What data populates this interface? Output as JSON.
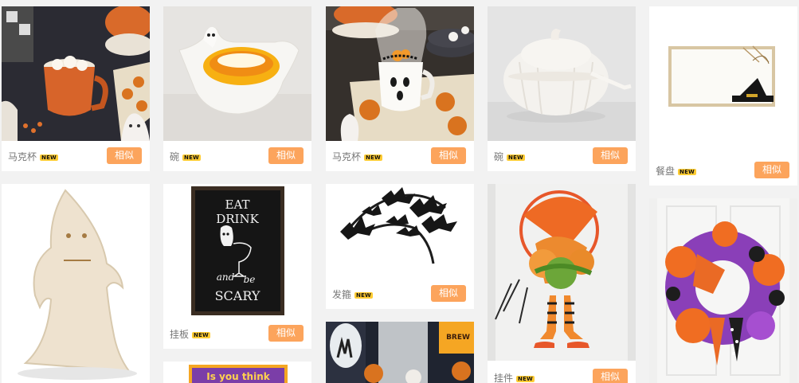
{
  "badge_text": "NEW",
  "similar_label": "相似",
  "accent_color": "#fca45c",
  "cards": [
    {
      "label": "马克杯",
      "image": "mug-with-marshmallows-and-ghost-figurine"
    },
    {
      "label": "碗",
      "image": "ghost-shaped-bowl-with-candy-corn"
    },
    {
      "label": "马克杯",
      "image": "ghost-mug-with-cellophane-gift-bag"
    },
    {
      "label": "碗",
      "image": "white-ceramic-pumpkin-tureen-with-ladle"
    },
    {
      "label": "餐盘",
      "image": "tray-with-witch-hat-and-twine"
    },
    {
      "label": "",
      "image": "burlap-ghost-figure"
    },
    {
      "label": "挂板",
      "image": "eat-drink-and-be-scary-sign"
    },
    {
      "label": "发箍",
      "image": "black-glitter-bats-headband"
    },
    {
      "label": "挂件",
      "image": "witch-hat-and-legs-door-wreath"
    },
    {
      "label": "",
      "image": "orange-purple-mesh-ribbon-wreath"
    },
    {
      "label": "",
      "image": "purple-card-partial"
    },
    {
      "label": "",
      "image": "halloween-table-setting-with-brew-mugs"
    }
  ],
  "sign_text": [
    "EAT",
    "DRINK",
    "and",
    "be",
    "SCARY"
  ],
  "card_text": "Is you think",
  "brew_text": "BREW"
}
